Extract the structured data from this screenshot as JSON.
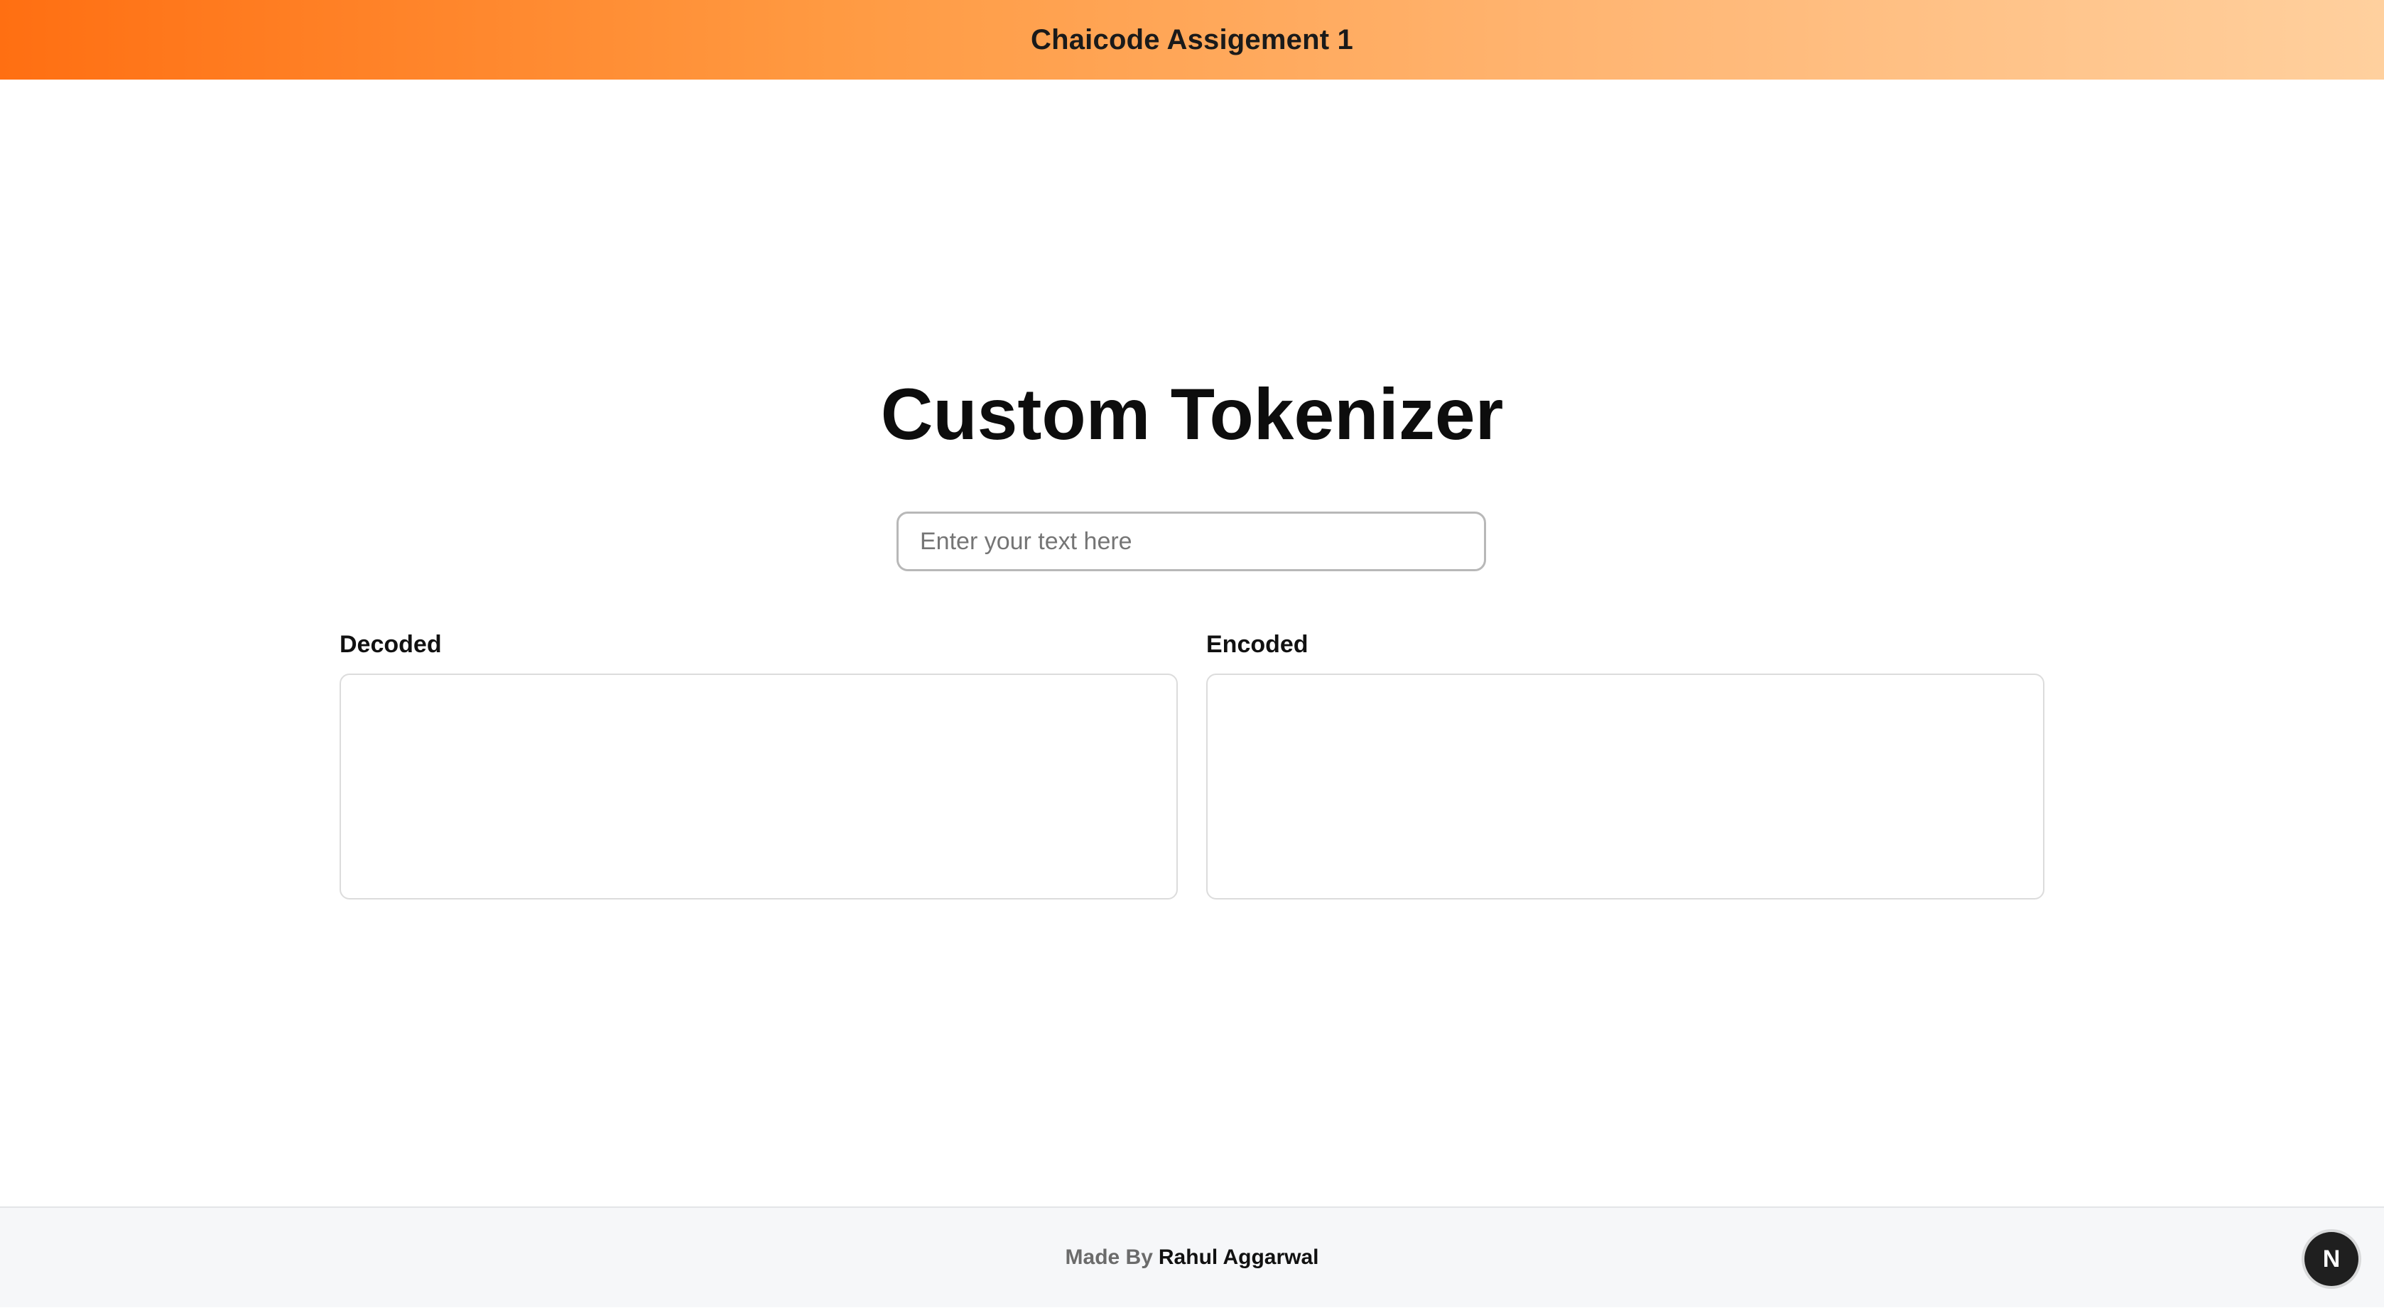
{
  "header": {
    "title": "Chaicode Assigement 1"
  },
  "main": {
    "title": "Custom Tokenizer",
    "input": {
      "placeholder": "Enter your text here",
      "value": ""
    },
    "panels": [
      {
        "label": "Decoded",
        "content": ""
      },
      {
        "label": "Encoded",
        "content": ""
      }
    ]
  },
  "footer": {
    "prefix": "Made By",
    "author": "Rahul Aggarwal"
  },
  "badge": {
    "icon": "nextjs-icon",
    "letter": "N"
  },
  "colors": {
    "header_gradient_start": "#ff6f12",
    "header_gradient_end": "#ffd09e",
    "footer_bg": "#f6f7f9",
    "badge_bg": "#1f1f1f"
  }
}
